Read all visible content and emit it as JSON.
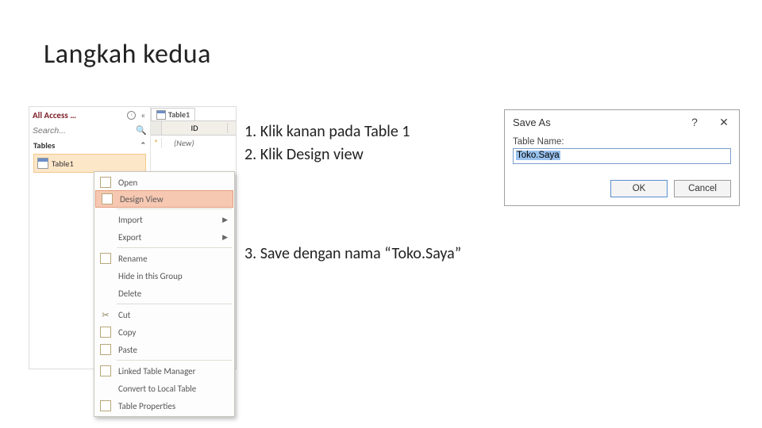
{
  "slide": {
    "title": "Langkah kedua"
  },
  "instructions": {
    "i1": "1.  Klik kanan pada Table 1",
    "i2": "2.  Klik Design view",
    "i3": "3.  Save dengan nama “Toko.Saya”"
  },
  "nav": {
    "header": "All Access …",
    "search_placeholder": "Search...",
    "group": "Tables",
    "item": "Table1"
  },
  "datasheet": {
    "tab": "Table1",
    "col": "ID",
    "new_val": "(New)"
  },
  "ctx": {
    "open": "Open",
    "design": "Design View",
    "import": "Import",
    "export": "Export",
    "rename": "Rename",
    "hide": "Hide in this Group",
    "delete": "Delete",
    "cut": "Cut",
    "copy": "Copy",
    "paste": "Paste",
    "ltm": "Linked Table Manager",
    "convert": "Convert to Local Table",
    "props": "Table Properties"
  },
  "saveas": {
    "title": "Save As",
    "label": "Table Name:",
    "value": "Toko.Saya",
    "ok": "OK",
    "cancel": "Cancel"
  }
}
